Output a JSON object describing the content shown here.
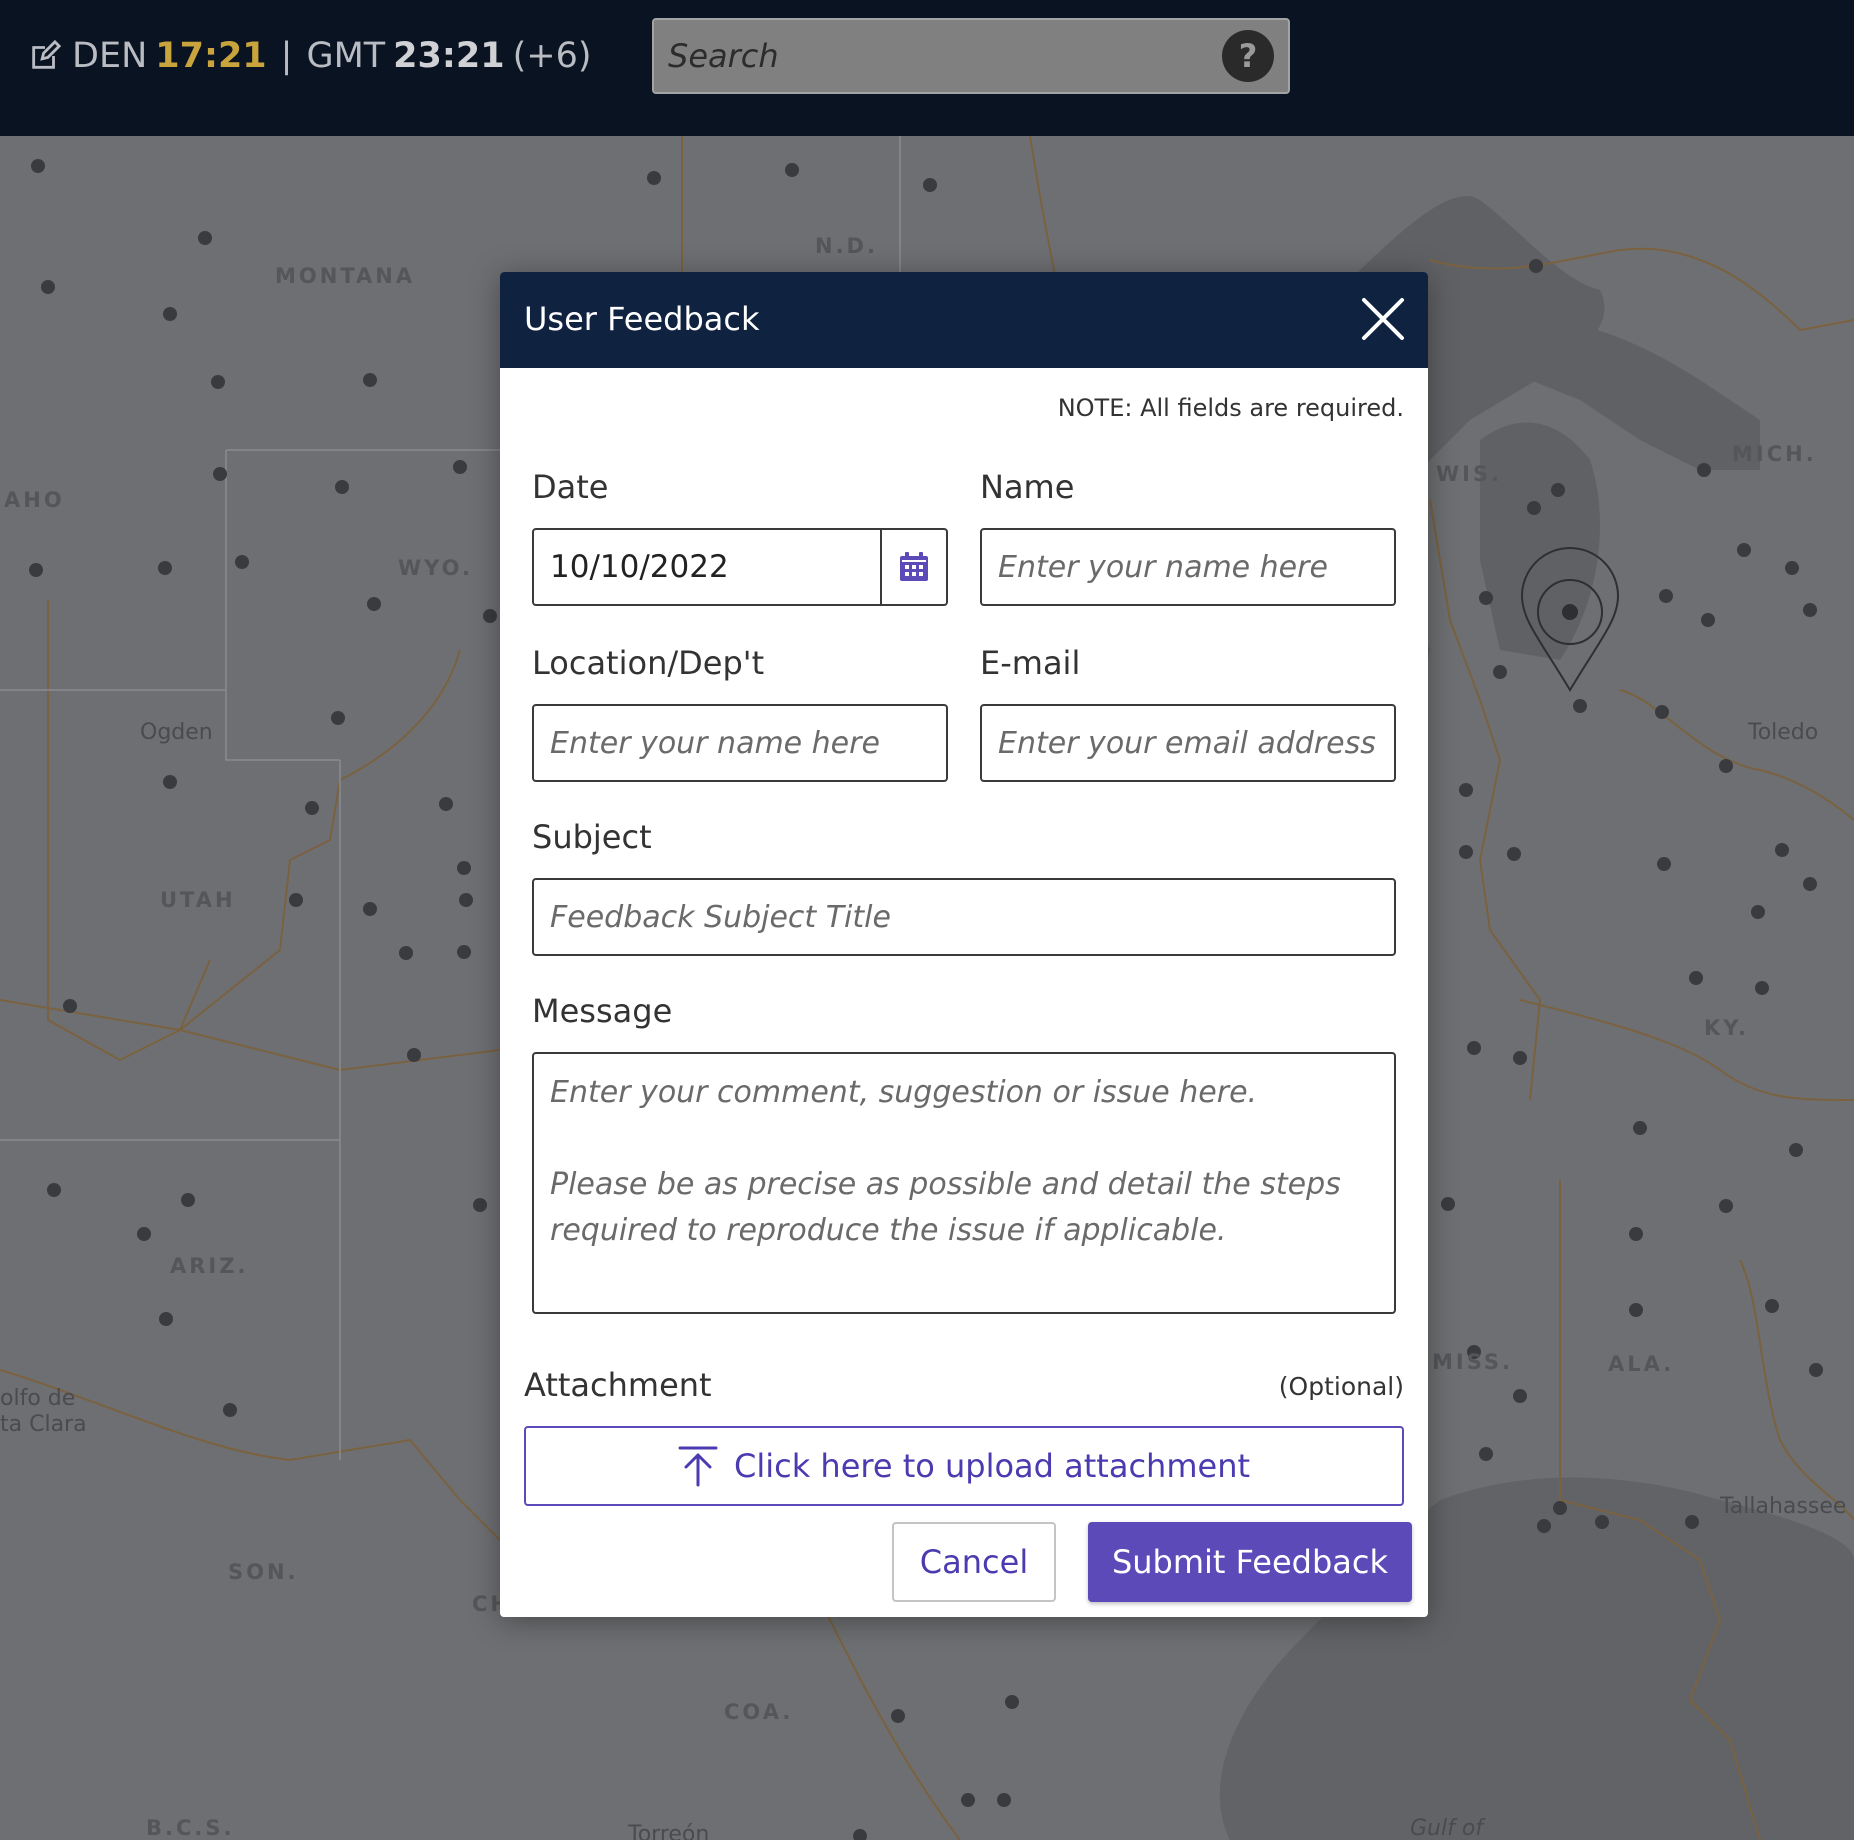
{
  "topbar": {
    "local_zone": "DEN",
    "local_time": "17:21",
    "separator": "|",
    "gmt_zone": "GMT",
    "gmt_time": "23:21",
    "offset": "(+6)",
    "search_placeholder": "Search",
    "help_label": "?"
  },
  "map": {
    "region_labels": [
      "N.D.",
      "MONTANA",
      "AHO",
      "WYO.",
      "UTAH",
      "ARIZ.",
      "SON.",
      "CH",
      "COA.",
      "B.C.S.",
      "WIS.",
      "MICH.",
      "KY.",
      "MISS.",
      "ALA."
    ],
    "city_labels": [
      "Ogden",
      "Toledo",
      "Tallahassee",
      "Torreón",
      "olfo de",
      "ta Clara",
      "Gulf of"
    ]
  },
  "modal": {
    "title": "User Feedback",
    "note": "NOTE: All fields are required.",
    "date": {
      "label": "Date",
      "value": "10/10/2022"
    },
    "name": {
      "label": "Name",
      "placeholder": "Enter your name here"
    },
    "location": {
      "label": "Location/Dep't",
      "placeholder": "Enter your name here"
    },
    "email": {
      "label": "E-mail",
      "placeholder": "Enter your email address"
    },
    "subject": {
      "label": "Subject",
      "placeholder": "Feedback Subject Title"
    },
    "message": {
      "label": "Message",
      "placeholder": "Enter your comment, suggestion or issue here.\n\nPlease be as precise as possible and detail the steps\nrequired to reproduce the issue if applicable."
    },
    "attachment": {
      "label": "Attachment",
      "optional": "(Optional)",
      "upload_label": "Click here to upload attachment"
    },
    "cancel_label": "Cancel",
    "submit_label": "Submit Feedback"
  },
  "colors": {
    "topbar_bg": "#0a1321",
    "header_bg": "#0f2240",
    "accent": "#5b4ab8",
    "local_time": "#c9a33b",
    "map_bg": "#6e6f72"
  }
}
